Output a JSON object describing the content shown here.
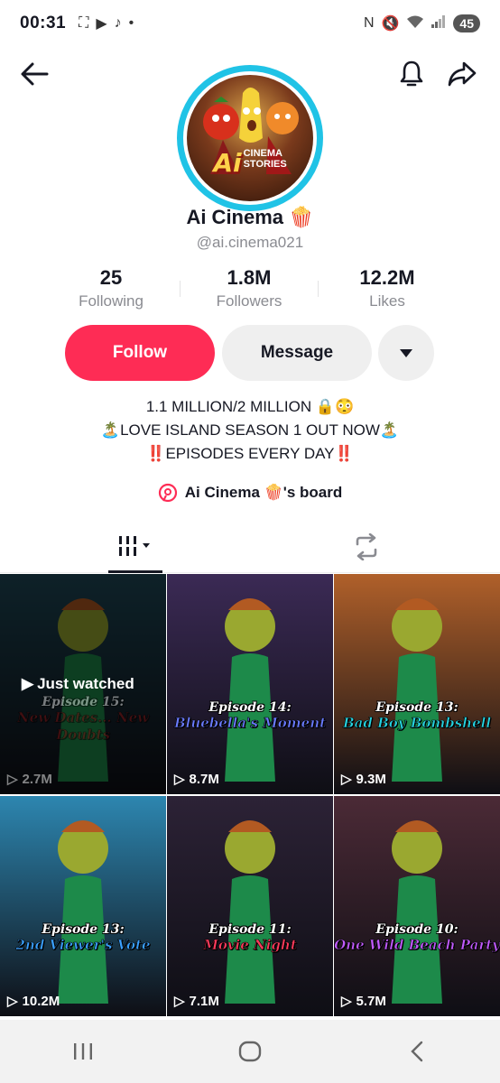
{
  "status_bar": {
    "time": "00:31",
    "battery": "45"
  },
  "profile": {
    "display_name": "Ai Cinema",
    "name_emoji": "🍿",
    "username": "@ai.cinema021",
    "avatar_logo_big": "Ai",
    "avatar_logo_line1": "CINEMA",
    "avatar_logo_line2": "STORIES"
  },
  "stats": [
    {
      "value": "25",
      "label": "Following"
    },
    {
      "value": "1.8M",
      "label": "Followers"
    },
    {
      "value": "12.2M",
      "label": "Likes"
    }
  ],
  "actions": {
    "follow": "Follow",
    "message": "Message"
  },
  "bio": {
    "line1": "1.1 MILLION/2 MILLION 🔒😳",
    "line2": "🏝️LOVE ISLAND SEASON 1 OUT NOW🏝️",
    "line3": "‼️EPISODES EVERY DAY‼️"
  },
  "board": {
    "label": "Ai Cinema 🍿's board"
  },
  "videos": [
    {
      "episode": "Episode 15:",
      "subtitle": "New Dates... New Doubts",
      "views": "2.7M",
      "just_watched": "Just watched",
      "bg": "#1f4a5a",
      "accent": "#7a1010"
    },
    {
      "episode": "Episode 14:",
      "subtitle": "Bluebella's Moment",
      "views": "8.7M",
      "bg": "#3b2a55",
      "accent": "#6a7bff"
    },
    {
      "episode": "Episode 13:",
      "subtitle": "Bad Boy Bombshell",
      "views": "9.3M",
      "bg": "#b0602a",
      "accent": "#27d3e0"
    },
    {
      "episode": "Episode 13:",
      "subtitle": "2nd Viewer's Vote",
      "views": "10.2M",
      "bg": "#2d86b0",
      "accent": "#3aa0ff"
    },
    {
      "episode": "Episode 11:",
      "subtitle": "Movie Night",
      "views": "7.1M",
      "bg": "#2c2236",
      "accent": "#ff3b5c"
    },
    {
      "episode": "Episode 10:",
      "subtitle": "One Wild Beach Party",
      "views": "5.7M",
      "bg": "#4b2a36",
      "accent": "#c15bff"
    }
  ],
  "colors": {
    "follow_button": "#fe2c55",
    "avatar_ring": "#20c3e6",
    "secondary_button": "#efefef"
  }
}
